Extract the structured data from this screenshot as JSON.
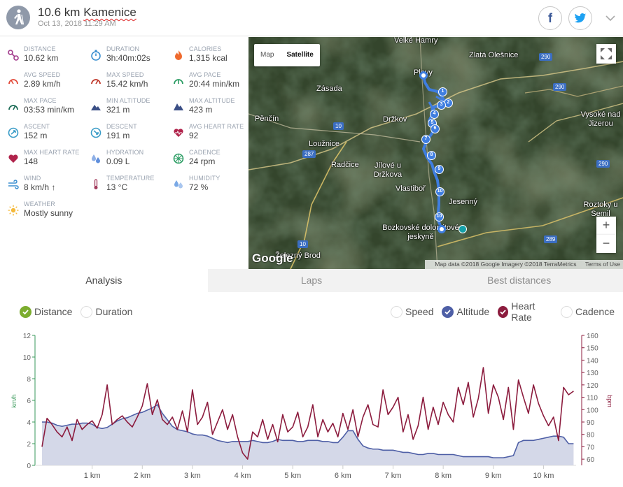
{
  "header": {
    "distance": "10.6 km",
    "place": "Kamenice",
    "datetime": "Oct 13, 2018 11:29 AM"
  },
  "stats": [
    {
      "label": "DISTANCE",
      "value": "10.62 km",
      "icon": "distance-icon"
    },
    {
      "label": "DURATION",
      "value": "3h:40m:02s",
      "icon": "stopwatch-icon"
    },
    {
      "label": "CALORIES",
      "value": "1,315 kcal",
      "icon": "flame-icon"
    },
    {
      "label": "AVG SPEED",
      "value": "2.89 km/h",
      "icon": "speedometer-icon"
    },
    {
      "label": "MAX SPEED",
      "value": "15.42 km/h",
      "icon": "speedometer-max-icon"
    },
    {
      "label": "AVG PACE",
      "value": "20:44 min/km",
      "icon": "pace-icon"
    },
    {
      "label": "MAX PACE",
      "value": "03:53 min/km",
      "icon": "pace-max-icon"
    },
    {
      "label": "MIN ALTITUDE",
      "value": "321 m",
      "icon": "mountain-min-icon"
    },
    {
      "label": "MAX ALTITUDE",
      "value": "423 m",
      "icon": "mountain-max-icon"
    },
    {
      "label": "ASCENT",
      "value": "152 m",
      "icon": "ascent-icon"
    },
    {
      "label": "DESCENT",
      "value": "191 m",
      "icon": "descent-icon"
    },
    {
      "label": "AVG HEART RATE",
      "value": "92",
      "icon": "heart-rate-icon"
    },
    {
      "label": "MAX HEART RATE",
      "value": "148",
      "icon": "heart-max-icon"
    },
    {
      "label": "HYDRATION",
      "value": "0.09 L",
      "icon": "water-drops-icon"
    },
    {
      "label": "CADENCE",
      "value": "24 rpm",
      "icon": "cadence-wheel-icon"
    },
    {
      "label": "WIND",
      "value": "8 km/h ↑",
      "icon": "wind-icon"
    },
    {
      "label": "TEMPERATURE",
      "value": "13 °C",
      "icon": "thermometer-icon"
    },
    {
      "label": "HUMIDITY",
      "value": "72 %",
      "icon": "humidity-icon"
    },
    {
      "label": "WEATHER",
      "value": "Mostly sunny",
      "icon": "sun-icon"
    }
  ],
  "map": {
    "toggle_map": "Map",
    "toggle_satellite": "Satellite",
    "zoom_in": "+",
    "zoom_out": "−",
    "google": "Google",
    "attribution": "Map data ©2018 Google Imagery ©2018 TerraMetrics",
    "terms": "Terms of Use",
    "labels": [
      "Velké Hamry",
      "Zlatá Olešnice",
      "Plavy",
      "Zásada",
      "Pěnčín",
      "Držkov",
      "Vysoké nad Jizerou",
      "Loužnice",
      "Radčice",
      "Jílové u Držkova",
      "Vlastiboř",
      "Jesenný",
      "Roztoky u Semil",
      "Bozkovské dolomitové jeskyně",
      "Železný Brod"
    ],
    "roads": [
      "290",
      "290",
      "10",
      "287",
      "290",
      "10",
      "289"
    ],
    "markers": [
      "1",
      "2",
      "3",
      "4",
      "5",
      "6",
      "7",
      "8",
      "9",
      "10",
      "10"
    ]
  },
  "tabs": [
    "Analysis",
    "Laps",
    "Best distances"
  ],
  "toggles": {
    "left": [
      {
        "label": "Distance",
        "checked": true
      },
      {
        "label": "Duration",
        "checked": false
      }
    ],
    "right": [
      {
        "label": "Speed",
        "checked": false
      },
      {
        "label": "Altitude",
        "checked": true
      },
      {
        "label": "Heart Rate",
        "checked": true
      },
      {
        "label": "Cadence",
        "checked": false
      }
    ]
  },
  "colors": {
    "check_green": "#7cad2f",
    "altitude": "#4e5fa6",
    "heart_rate": "#8c1c3e",
    "speed_axis": "#3a9a5b"
  },
  "chart_data": {
    "type": "line",
    "x": [
      0,
      0.1,
      0.2,
      0.3,
      0.4,
      0.5,
      0.6,
      0.7,
      0.8,
      0.9,
      1.0,
      1.1,
      1.2,
      1.3,
      1.4,
      1.5,
      1.6,
      1.7,
      1.8,
      1.9,
      2.0,
      2.1,
      2.2,
      2.3,
      2.4,
      2.5,
      2.6,
      2.7,
      2.8,
      2.9,
      3.0,
      3.1,
      3.2,
      3.3,
      3.4,
      3.5,
      3.6,
      3.7,
      3.8,
      3.9,
      4.0,
      4.1,
      4.2,
      4.3,
      4.4,
      4.5,
      4.6,
      4.7,
      4.8,
      4.9,
      5.0,
      5.1,
      5.2,
      5.3,
      5.4,
      5.5,
      5.6,
      5.7,
      5.8,
      5.9,
      6.0,
      6.1,
      6.2,
      6.3,
      6.4,
      6.5,
      6.6,
      6.7,
      6.8,
      6.9,
      7.0,
      7.1,
      7.2,
      7.3,
      7.4,
      7.5,
      7.6,
      7.7,
      7.8,
      7.9,
      8.0,
      8.1,
      8.2,
      8.3,
      8.4,
      8.5,
      8.6,
      8.7,
      8.8,
      8.9,
      9.0,
      9.1,
      9.2,
      9.3,
      9.4,
      9.5,
      9.6,
      9.7,
      9.8,
      9.9,
      10.0,
      10.1,
      10.2,
      10.3,
      10.4,
      10.5,
      10.6
    ],
    "xlabel": "",
    "x_ticks": [
      "1 km",
      "2 km",
      "3 km",
      "4 km",
      "5 km",
      "6 km",
      "7 km",
      "8 km",
      "9 km",
      "10 km"
    ],
    "x_tick_values": [
      1,
      2,
      3,
      4,
      5,
      6,
      7,
      8,
      9,
      10
    ],
    "xlim": [
      0,
      10.65
    ],
    "y_left": {
      "label": "km/h",
      "ticks": [
        "0",
        "2",
        "4",
        "6",
        "8",
        "10",
        "12"
      ],
      "lim": [
        0,
        12
      ]
    },
    "y_right": {
      "label": "bpm",
      "ticks": [
        "60",
        "70",
        "80",
        "90",
        "100",
        "110",
        "120",
        "130",
        "140",
        "150",
        "160"
      ],
      "lim": [
        55,
        160
      ]
    },
    "series": [
      {
        "name": "Altitude",
        "axis": "left",
        "values": [
          4.0,
          4.0,
          3.9,
          3.7,
          3.6,
          3.7,
          3.8,
          3.8,
          3.9,
          3.9,
          3.8,
          3.5,
          3.4,
          3.5,
          3.8,
          4.1,
          4.3,
          4.4,
          4.6,
          4.8,
          4.9,
          5.1,
          5.3,
          5.6,
          4.8,
          4.2,
          3.6,
          3.3,
          3.2,
          3.1,
          2.9,
          2.8,
          2.8,
          2.7,
          2.5,
          2.3,
          2.2,
          2.1,
          2.2,
          2.2,
          2.2,
          2.2,
          2.3,
          2.2,
          2.1,
          2.1,
          2.2,
          2.4,
          2.3,
          2.3,
          2.3,
          2.2,
          2.2,
          2.3,
          2.3,
          2.3,
          2.2,
          2.2,
          2.1,
          2.1,
          2.6,
          3.2,
          3.2,
          2.4,
          1.8,
          1.6,
          1.5,
          1.5,
          1.4,
          1.4,
          1.4,
          1.3,
          1.2,
          1.2,
          1.1,
          1.0,
          1.0,
          1.1,
          1.1,
          1.0,
          1.0,
          1.0,
          1.0,
          0.9,
          0.8,
          0.8,
          0.8,
          0.8,
          0.8,
          0.8,
          0.7,
          0.7,
          0.7,
          0.8,
          0.9,
          2.1,
          2.3,
          2.3,
          2.3,
          2.4,
          2.5,
          2.6,
          2.7,
          2.7,
          2.6,
          2.0,
          2.0
        ]
      },
      {
        "name": "Heart Rate",
        "axis": "right",
        "values": [
          70,
          93,
          88,
          82,
          78,
          86,
          75,
          92,
          84,
          88,
          91,
          85,
          96,
          120,
          88,
          92,
          95,
          90,
          86,
          94,
          103,
          121,
          96,
          108,
          92,
          88,
          94,
          84,
          99,
          82,
          116,
          88,
          94,
          106,
          80,
          90,
          100,
          84,
          96,
          78,
          65,
          60,
          82,
          78,
          92,
          76,
          88,
          74,
          96,
          82,
          86,
          98,
          78,
          86,
          104,
          78,
          92,
          82,
          89,
          78,
          97,
          84,
          100,
          78,
          94,
          104,
          88,
          86,
          116,
          96,
          102,
          110,
          82,
          96,
          76,
          87,
          110,
          84,
          102,
          88,
          106,
          96,
          90,
          118,
          104,
          122,
          94,
          109,
          134,
          97,
          120,
          110,
          92,
          118,
          84,
          124,
          110,
          97,
          120,
          105,
          95,
          87,
          94,
          75,
          118,
          112,
          115
        ]
      }
    ]
  }
}
